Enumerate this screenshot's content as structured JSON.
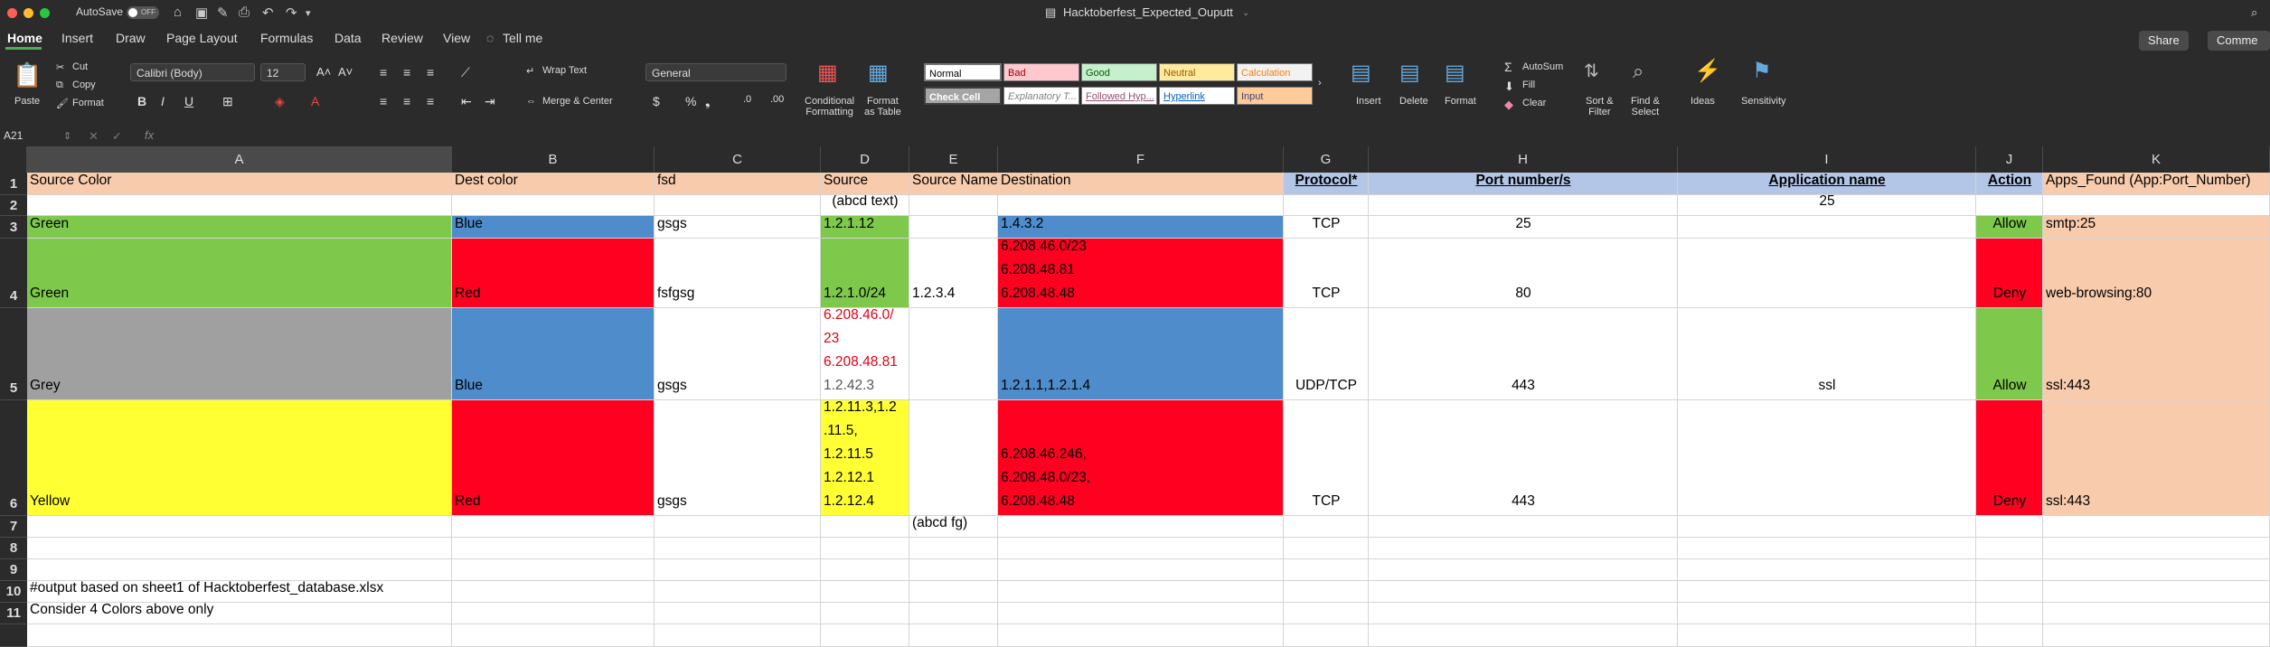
{
  "app": {
    "autosave_label": "AutoSave",
    "autosave_state": "OFF",
    "title": "Hacktoberfest_Expected_Ouputt",
    "share_label": "Share",
    "comments_label": "Comme"
  },
  "tabs": [
    "Home",
    "Insert",
    "Draw",
    "Page Layout",
    "Formulas",
    "Data",
    "Review",
    "View"
  ],
  "tell_me": "Tell me",
  "ribbon": {
    "paste": "Paste",
    "cut": "Cut",
    "copy": "Copy",
    "format": "Format",
    "font_name": "Calibri (Body)",
    "font_size": "12",
    "bold": "B",
    "italic": "I",
    "underline": "U",
    "wrap_text": "Wrap Text",
    "merge_center": "Merge & Center",
    "number_format": "General",
    "conditional_formatting": [
      "Conditional",
      "Formatting"
    ],
    "format_as_table": [
      "Format",
      "as Table"
    ],
    "styles": {
      "normal": "Normal",
      "bad": "Bad",
      "good": "Good",
      "neutral": "Neutral",
      "calculation": "Calculation",
      "check_cell": "Check Cell",
      "explanatory": "Explanatory T...",
      "followed_hyp": "Followed Hyp...",
      "hyperlink": "Hyperlink",
      "input": "Input"
    },
    "insert": "Insert",
    "delete": "Delete",
    "format_cells": "Format",
    "autosum": "AutoSum",
    "fill": "Fill",
    "clear": "Clear",
    "sort_filter": [
      "Sort &",
      "Filter"
    ],
    "find_select": [
      "Find &",
      "Select"
    ],
    "ideas": "Ideas",
    "sensitivity": "Sensitivity"
  },
  "formula_bar": {
    "cell_ref": "A21",
    "fx": "fx",
    "value": ""
  },
  "columns": [
    "A",
    "B",
    "C",
    "D",
    "E",
    "F",
    "G",
    "H",
    "I",
    "J",
    "K"
  ],
  "rows": [
    "1",
    "2",
    "3",
    "4",
    "5",
    "6",
    "7",
    "8",
    "9",
    "10",
    "11"
  ],
  "cells": {
    "A1": "Source Color",
    "B1": "Dest color",
    "C1": "fsd",
    "D1": "Source",
    "E1": "Source Name",
    "F1": "Destination",
    "G1": "Protocol*",
    "H1": "Port number/s",
    "I1": "Application name",
    "J1": "Action",
    "K1": "Apps_Found (App:Port_Number)",
    "D2": "(abcd text)",
    "I2": "25",
    "A3": "Green",
    "B3": "Blue",
    "C3": "gsgs",
    "D3": "1.2.1.12",
    "F3": "1.4.3.2",
    "G3": "TCP",
    "H3": "25",
    "J3": "Allow",
    "K3": "smtp:25",
    "A4": "Green",
    "B4": "Red",
    "C4": "fsfgsg",
    "D4": "1.2.1.0/24",
    "E4": "1.2.3.4",
    "F4": "6.208.46.0/23\n6.208.48.81\n6.208.48.48",
    "G4": "TCP",
    "H4": "80",
    "J4": "Deny",
    "K4": "web-browsing:80",
    "A5": "Grey",
    "B5": "Blue",
    "C5": "gsgs",
    "D5_red": "6.208.46.0/\n23\n6.208.48.81",
    "D5_grey": "1.2.42.3",
    "F5": "1.2.1.1,1.2.1.4",
    "G5": "UDP/TCP",
    "H5": "443",
    "I5": "ssl",
    "J5": "Allow",
    "K5": "ssl:443",
    "A6": "Yellow",
    "B6": "Red",
    "C6": "gsgs",
    "D6": "1.2.11.3,1.2\n.11.5,\n1.2.11.5\n1.2.12.1\n1.2.12.4",
    "F6": "6.208.46.246,\n6.208.48.0/23,\n6.208.48.48",
    "G6": "TCP",
    "H6": "443",
    "J6": "Deny",
    "K6": "ssl:443",
    "E7": "(abcd fg)",
    "A10": "#output based on sheet1 of Hacktoberfest_database.xlsx",
    "A11": "Consider 4 Colors above only"
  },
  "colors": {
    "green": "#7ec94c",
    "blue": "#4f8ccc",
    "red": "#ff0020",
    "grey": "#a0a0a0",
    "yellow": "#ffff33",
    "peach": "#f8cbad",
    "header_blue": "#b4c6e7"
  }
}
